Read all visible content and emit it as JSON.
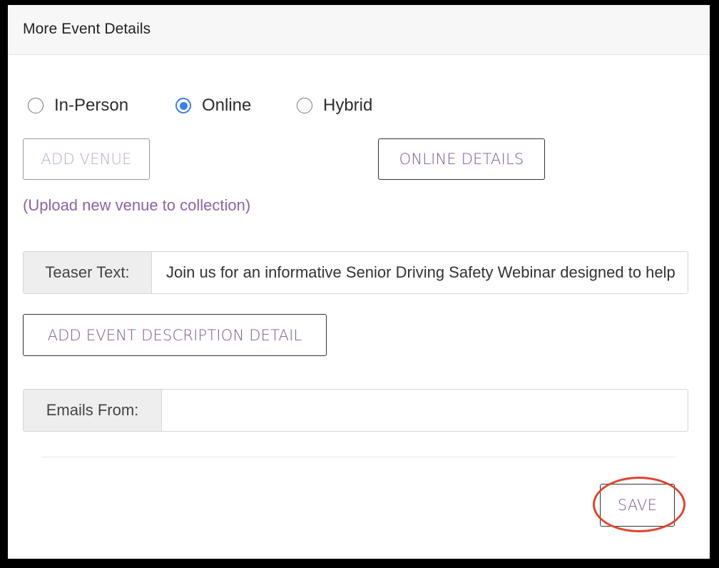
{
  "panel": {
    "title": "More Event Details"
  },
  "event_type": {
    "options": [
      {
        "label": "In-Person",
        "checked": false
      },
      {
        "label": "Online",
        "checked": true
      },
      {
        "label": "Hybrid",
        "checked": false
      }
    ]
  },
  "buttons": {
    "add_venue": "ADD VENUE",
    "online_details": "ONLINE DETAILS",
    "add_event_description": "ADD EVENT DESCRIPTION DETAIL",
    "save": "SAVE"
  },
  "upload_link": "(Upload new venue to collection)",
  "teaser": {
    "label": "Teaser Text:",
    "value": "Join us for an informative Senior Driving Safety Webinar designed to help"
  },
  "emails_from": {
    "label": "Emails From:",
    "value": ""
  },
  "colors": {
    "accent_purple": "#7a5a94",
    "radio_blue": "#3a7ff0",
    "highlight_red": "#e0452f"
  }
}
